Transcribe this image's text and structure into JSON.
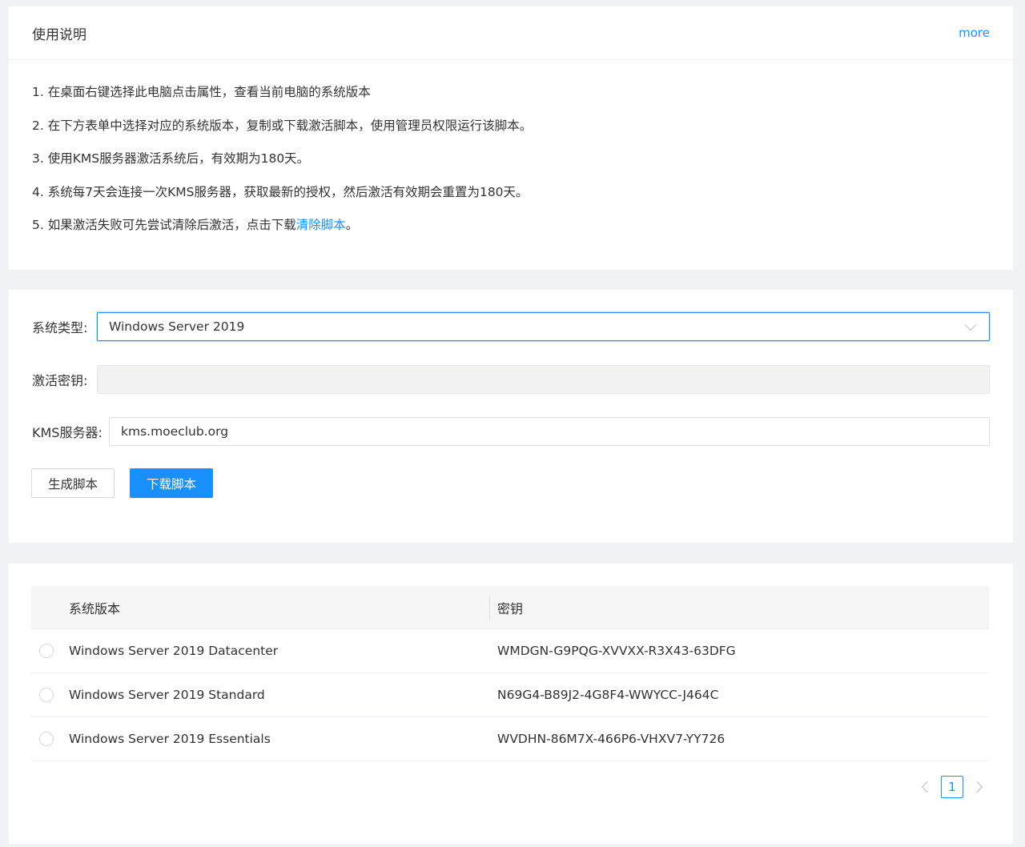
{
  "instructions": {
    "title": "使用说明",
    "more_label": "more",
    "steps": [
      "1. 在桌面右键选择此电脑点击属性，查看当前电脑的系统版本",
      "2. 在下方表单中选择对应的系统版本，复制或下载激活脚本，使用管理员权限运行该脚本。",
      "3. 使用KMS服务器激活系统后，有效期为180天。",
      "4. 系统每7天会连接一次KMS服务器，获取最新的授权，然后激活有效期会重置为180天。"
    ],
    "step5_text": "5. 如果激活失败可先尝试清除后激活，点击下载",
    "step5_link": "清除脚本",
    "step5_tail": "。"
  },
  "form": {
    "type_label": "系统类型:",
    "type_value": "Windows Server 2019",
    "key_label": "激活密钥:",
    "key_value": "",
    "kms_label": "KMS服务器:",
    "kms_value": "kms.moeclub.org",
    "generate_label": "生成脚本",
    "download_label": "下载脚本"
  },
  "table": {
    "headers": [
      "系统版本",
      "密钥"
    ],
    "rows": [
      {
        "version": "Windows Server 2019 Datacenter",
        "key": "WMDGN-G9PQG-XVVXX-R3X43-63DFG"
      },
      {
        "version": "Windows Server 2019 Standard",
        "key": "N69G4-B89J2-4G8F4-WWYCC-J464C"
      },
      {
        "version": "Windows Server 2019 Essentials",
        "key": "WVDHN-86M7X-466P6-VHXV7-YY726"
      }
    ],
    "page": "1"
  },
  "colors": {
    "accent": "#1890ff",
    "background": "#f0f2f5",
    "header_bg": "#f5f5f5"
  },
  "icons": {
    "select_arrow": "chevron-down-icon",
    "prev": "chevron-left-icon",
    "next": "chevron-right-icon"
  }
}
